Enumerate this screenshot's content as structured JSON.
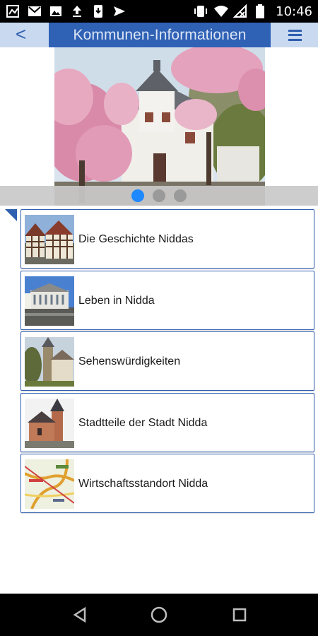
{
  "status_bar": {
    "time": "10:46",
    "left_icons": [
      "map-icon",
      "gmail-icon",
      "image-icon",
      "upload-icon",
      "download-icon",
      "send-icon"
    ],
    "right_icons": [
      "vibrate-icon",
      "wifi-icon",
      "no-signal-icon",
      "battery-icon"
    ]
  },
  "header": {
    "back_label": "<",
    "title": "Kommunen-Informationen",
    "menu_icon": "hamburger-menu-icon"
  },
  "slider": {
    "dot_count": 3,
    "active_index": 0,
    "image": "castle-with-blossom-trees-photo"
  },
  "menu_items": [
    {
      "label": "Die Geschichte Niddas",
      "thumb": "half-timbered-houses-photo"
    },
    {
      "label": "Leben in Nidda",
      "thumb": "town-square-photo"
    },
    {
      "label": "Sehenswürdigkeiten",
      "thumb": "church-tower-photo"
    },
    {
      "label": "Stadtteile der Stadt Nidda",
      "thumb": "village-church-photo"
    },
    {
      "label": "Wirtschaftsstandort Nidda",
      "thumb": "regional-map-photo"
    }
  ],
  "colors": {
    "header_bar": "#2f61b5",
    "header_bg": "#c9d9ef",
    "accent": "#2f5fb0",
    "dot_active": "#1e88ff",
    "dot_inactive": "#9a9a9a"
  }
}
